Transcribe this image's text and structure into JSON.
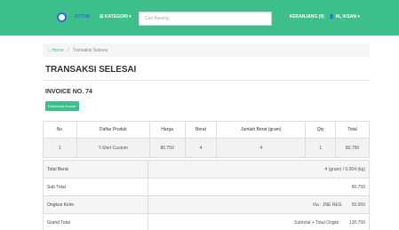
{
  "navbar": {
    "logo_text": "JOTOB",
    "kategori": "☰ KATEGORI ▾",
    "search_placeholder": "Cari Barang",
    "cart": "🛒 KERANJANG (0)",
    "user": "👤 Hi, IKSAN ▾"
  },
  "breadcrumb": {
    "home": "Home",
    "separator": "/",
    "current": "Transaksi Selesai"
  },
  "page": {
    "title": "TRANSAKSI SELESAI",
    "invoice": "INVOICE NO. 74",
    "download_label": "Download Invoice"
  },
  "items_table": {
    "headers": [
      "No.",
      "Daftar Produk",
      "Harga",
      "Berat",
      "Jumlah Berat (gram)",
      "Qty",
      "Total"
    ],
    "rows": [
      [
        "1",
        "T-Shirt Custom",
        "80,750",
        "4",
        "4",
        "1",
        "80,750"
      ]
    ]
  },
  "summary": {
    "total_berat_label": "Total Berat",
    "total_berat_value": "4 (gram) / 0.004 (kg)",
    "subtotal_label": "Sub Total",
    "subtotal_value": "80,750",
    "ongkos_label": "Ongkos Kirim",
    "ongkos_value": "Via : JNE REG        50,000",
    "grand_label": "Grand Total",
    "grand_value": "Subtotal + Total Ongkir        130,750"
  },
  "colors": {
    "accent": "#3cbf8a",
    "brand_blue": "#2b6fd6"
  }
}
